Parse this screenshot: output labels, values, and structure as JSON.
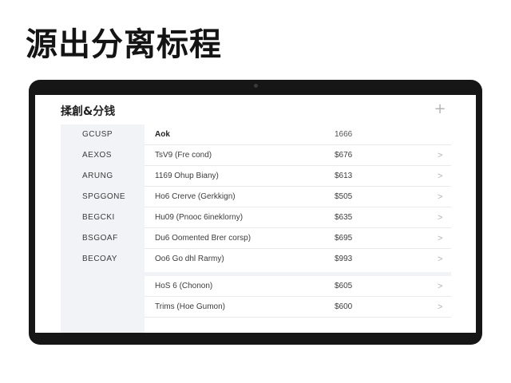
{
  "heading": "源出分离标程",
  "screen": {
    "title": "揉創&分钱",
    "add_icon": "+"
  },
  "sidebar": {
    "items": [
      {
        "label": "GCUSP"
      },
      {
        "label": "AEXOS"
      },
      {
        "label": "ARUNG"
      },
      {
        "label": "SPGGONE"
      },
      {
        "label": "BEGCKI"
      },
      {
        "label": "BSGOAF"
      },
      {
        "label": "BECOAY"
      }
    ]
  },
  "table": {
    "header": {
      "name": "Aok",
      "price": "1666"
    },
    "rows": [
      {
        "name": "TsV9 (Fre cond)",
        "price": "$676"
      },
      {
        "name": "1169 Ohup Biany)",
        "price": "$613"
      },
      {
        "name": "Ho6 Crerve (Gerkkign)",
        "price": "$505"
      },
      {
        "name": "Hu09 (Pnooc 6ineklorny)",
        "price": "$635"
      },
      {
        "name": "Du6 Oomented Brer corsp)",
        "price": "$695"
      },
      {
        "name": "Oo6 Go dhl Rarmy)",
        "price": "$993"
      }
    ],
    "rows_secondary": [
      {
        "name": "HoS 6 (Chonon)",
        "price": "$605"
      },
      {
        "name": "Trims (Hoe Gumon)",
        "price": "$600"
      }
    ],
    "chevron": ">"
  }
}
